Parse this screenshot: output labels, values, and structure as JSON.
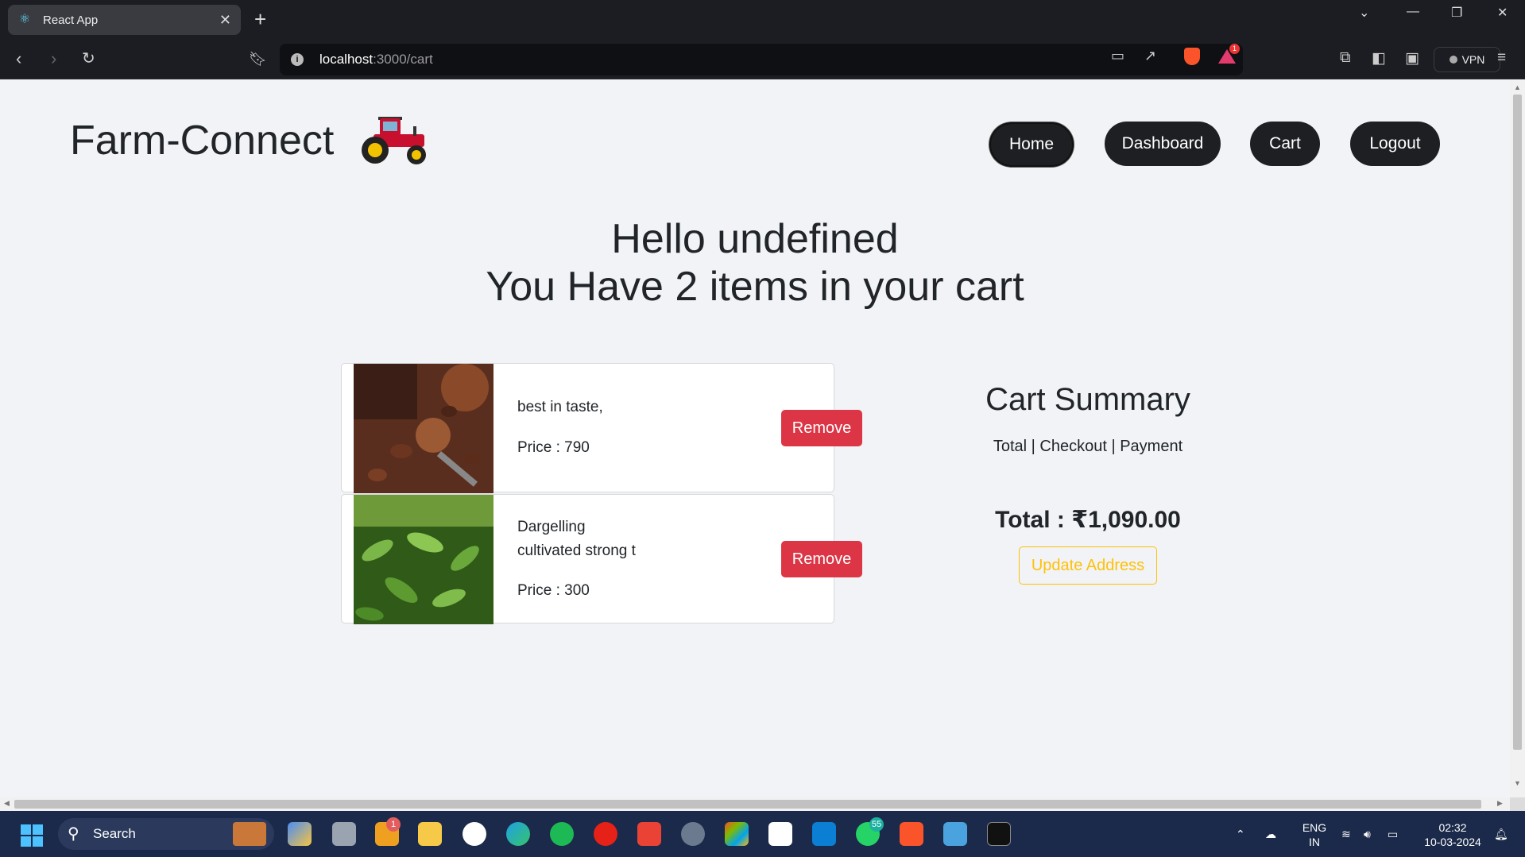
{
  "browser": {
    "tab_title": "React App",
    "url_host": "localhost",
    "url_path": ":3000/cart",
    "vpn_label": "VPN",
    "alert_badge": "1"
  },
  "nav": {
    "brand": "Farm-Connect",
    "home": "Home",
    "dashboard": "Dashboard",
    "cart": "Cart",
    "logout": "Logout"
  },
  "greeting": {
    "line1": "Hello undefined",
    "line2": "You Have 2 items in your cart"
  },
  "cart_items": [
    {
      "desc_line1": "best in taste,",
      "desc_line2": "",
      "price": "Price : 790",
      "remove_label": "Remove",
      "image": "cocoa-beans"
    },
    {
      "desc_line1": "Dargelling",
      "desc_line2": "cultivated strong t",
      "price": "Price : 300",
      "remove_label": "Remove",
      "image": "tea-leaves"
    }
  ],
  "summary": {
    "title": "Cart Summary",
    "subtitle": "Total | Checkout | Payment",
    "total": "Total : ₹1,090.00",
    "update_address": "Update Address"
  },
  "taskbar": {
    "search_placeholder": "Search",
    "language_line1": "ENG",
    "language_line2": "IN",
    "time": "02:32",
    "date": "10-03-2024",
    "badges": {
      "app_a": "1",
      "whatsapp": "55"
    }
  }
}
